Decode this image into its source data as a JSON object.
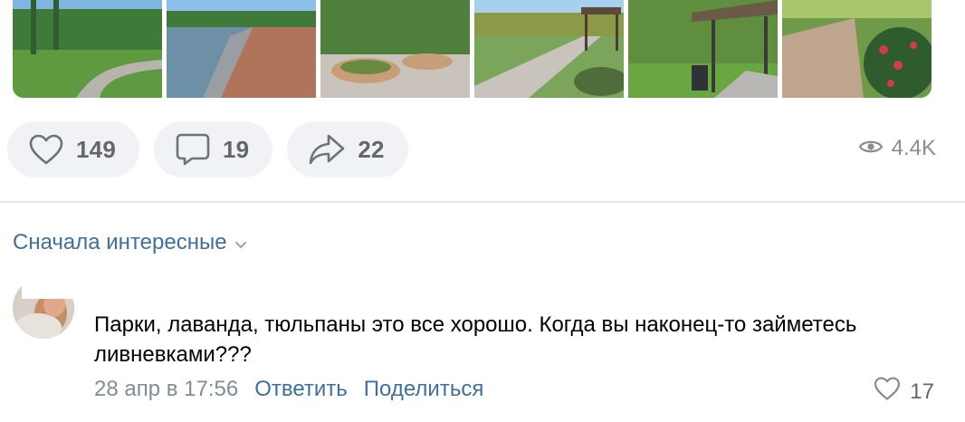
{
  "photos": [
    {
      "alt": "park-path-photo"
    },
    {
      "alt": "river-promenade-photo"
    },
    {
      "alt": "round-benches-photo"
    },
    {
      "alt": "gazebo-path-photo"
    },
    {
      "alt": "pavilion-lawn-photo"
    },
    {
      "alt": "flower-path-photo"
    }
  ],
  "actions": {
    "likes": "149",
    "comments": "19",
    "shares": "22",
    "views": "4.4K"
  },
  "sort": {
    "label": "Сначала интересные"
  },
  "comment": {
    "text": "Парки, лаванда, тюльпаны это все хорошо. Когда вы наконец-то займетесь ливневками???",
    "time": "28 апр в 17:56",
    "reply_label": "Ответить",
    "share_label": "Поделиться",
    "likes": "17"
  },
  "colors": {
    "accent": "#3f6fa0",
    "pill_bg": "#f0f2f5",
    "muted": "#818c99"
  }
}
